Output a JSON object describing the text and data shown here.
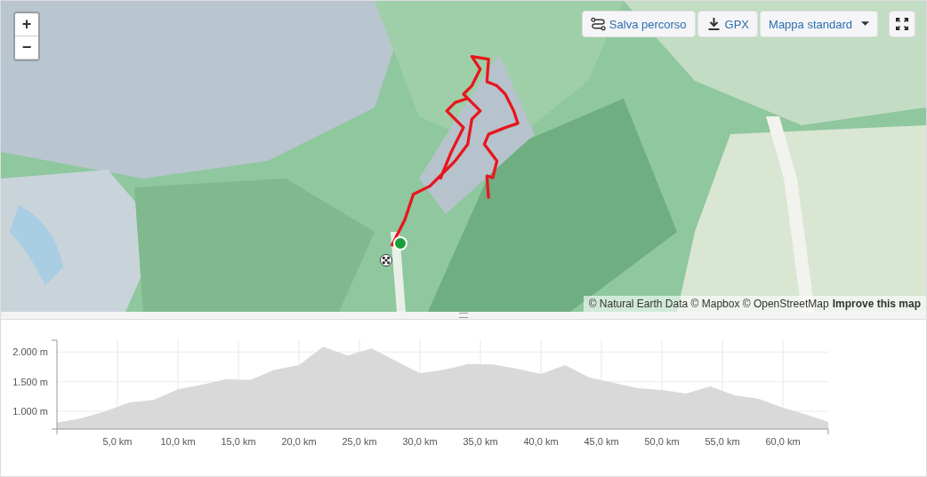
{
  "map": {
    "zoom_in": "+",
    "zoom_out": "−",
    "toolbar": [
      {
        "kind": "save",
        "label": "Salva percorso"
      },
      {
        "kind": "download",
        "label": "GPX"
      },
      {
        "kind": "dropdown",
        "label": "Mappa standard"
      }
    ],
    "attribution": "© Natural Earth Data © Mapbox © OpenStreetMap",
    "improve_link": "Improve this map"
  },
  "elevation": {
    "chart_data": {
      "type": "area",
      "x": [
        0,
        2,
        4,
        6,
        8,
        10,
        12,
        14,
        16,
        18,
        20,
        22,
        24,
        26,
        28,
        30,
        32,
        34,
        36,
        38,
        40,
        42,
        44,
        46,
        48,
        50,
        52,
        54,
        56,
        58,
        60,
        62,
        63.75
      ],
      "grid": true,
      "series": [
        {
          "color": "#d9d9d9",
          "values": [
            810,
            880,
            1000,
            1150,
            1190,
            1370,
            1450,
            1540,
            1530,
            1700,
            1780,
            2090,
            1940,
            2060,
            1850,
            1640,
            1700,
            1800,
            1790,
            1720,
            1630,
            1780,
            1570,
            1480,
            1390,
            1360,
            1300,
            1420,
            1270,
            1210,
            1060,
            940,
            820
          ]
        }
      ],
      "xlim": [
        0,
        63.75
      ],
      "ylim": [
        700,
        2200
      ],
      "xticks": [
        {
          "value": 5,
          "label": "5,0 km"
        },
        {
          "value": 10,
          "label": "10,0 km"
        },
        {
          "value": 15,
          "label": "15,0 km"
        },
        {
          "value": 20,
          "label": "20,0 km"
        },
        {
          "value": 25,
          "label": "25,0 km"
        },
        {
          "value": 30,
          "label": "30,0 km"
        },
        {
          "value": 35,
          "label": "35,0 km"
        },
        {
          "value": 40,
          "label": "40,0 km"
        },
        {
          "value": 45,
          "label": "45,0 km"
        },
        {
          "value": 50,
          "label": "50,0 km"
        },
        {
          "value": 55,
          "label": "55,0 km"
        },
        {
          "value": 60,
          "label": "60,0 km"
        }
      ],
      "yticks": [
        {
          "value": 1000,
          "label": "1.000 m"
        },
        {
          "value": 1500,
          "label": "1.500 m"
        },
        {
          "value": 2000,
          "label": "2.000 m"
        }
      ]
    }
  }
}
